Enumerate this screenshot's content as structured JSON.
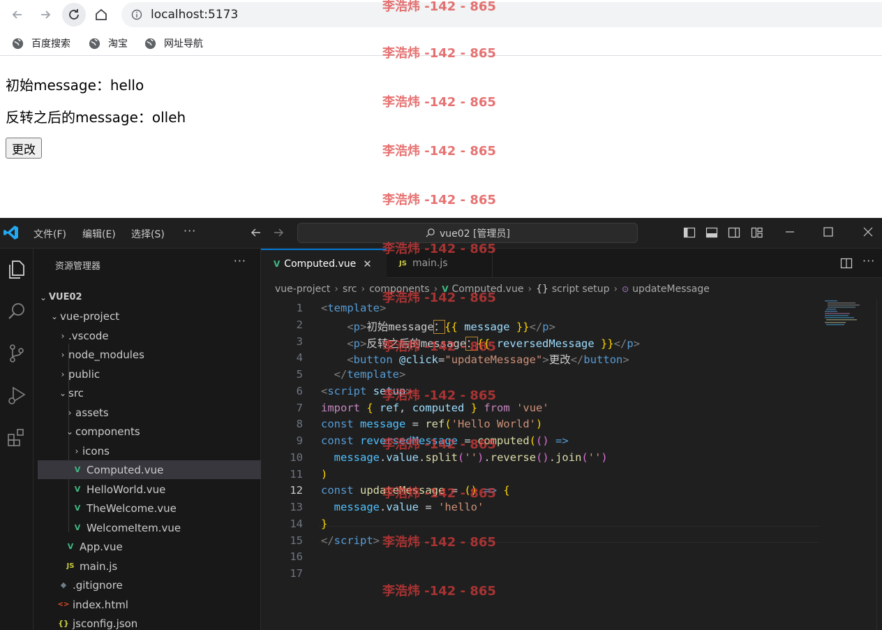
{
  "browser": {
    "url": "localhost:5173",
    "bookmarks": [
      "百度搜索",
      "淘宝",
      "网址导航"
    ]
  },
  "page": {
    "line1": "初始message：hello",
    "line2": "反转之后的message：olleh",
    "button": "更改"
  },
  "vscode": {
    "menus": [
      "文件(F)",
      "编辑(E)",
      "选择(S)"
    ],
    "more": "···",
    "search": "vue02 [管理员]",
    "explorer_title": "资源管理器",
    "explorer_more": "···",
    "tree": [
      {
        "label": "VUE02",
        "icon": "",
        "bold": true
      },
      {
        "label": "vue-project",
        "icon": ""
      },
      {
        "label": ".vscode",
        "icon": ""
      },
      {
        "label": "node_modules",
        "icon": ""
      },
      {
        "label": "public",
        "icon": ""
      },
      {
        "label": "src",
        "icon": ""
      },
      {
        "label": "assets",
        "icon": ""
      },
      {
        "label": "components",
        "icon": ""
      },
      {
        "label": "icons",
        "icon": ""
      },
      {
        "label": "Computed.vue",
        "icon": "V"
      },
      {
        "label": "HelloWorld.vue",
        "icon": "V"
      },
      {
        "label": "TheWelcome.vue",
        "icon": "V"
      },
      {
        "label": "WelcomeItem.vue",
        "icon": "V"
      },
      {
        "label": "App.vue",
        "icon": "V"
      },
      {
        "label": "main.js",
        "icon": "JS"
      },
      {
        "label": ".gitignore",
        "icon": "◆"
      },
      {
        "label": "index.html",
        "icon": "<>"
      },
      {
        "label": "jsconfig.json",
        "icon": "{}"
      }
    ],
    "tabs": [
      {
        "label": "Computed.vue",
        "close": "✕"
      },
      {
        "label": "main.js"
      }
    ],
    "breadcrumb": [
      "vue-project",
      "src",
      "components",
      "Computed.vue",
      "script setup",
      "updateMessage"
    ],
    "line_numbers": [
      "1",
      "2",
      "3",
      "4",
      "5",
      "6",
      "7",
      "8",
      "9",
      "10",
      "11",
      "12",
      "13",
      "14",
      "15",
      "16",
      "17"
    ]
  },
  "watermark": "李浩炜 -142 - 865",
  "colors": {
    "accent": "#0078d4",
    "vue_green": "#41b883",
    "js_yellow": "#cbcb41",
    "watermark": "#de3c3c"
  }
}
